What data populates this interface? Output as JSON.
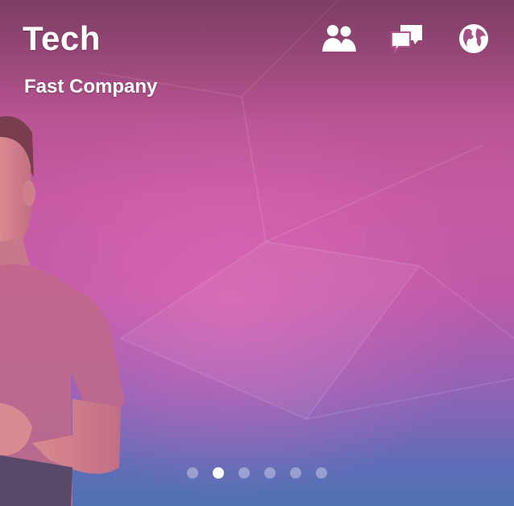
{
  "header": {
    "title": "Tech",
    "source": "Fast Company"
  },
  "toolbar": {
    "icons": [
      "people-icon",
      "chat-bubbles-icon",
      "globe-icon"
    ]
  },
  "pager": {
    "count": 6,
    "active_index": 1
  },
  "colors": {
    "top": "#9b4f7e",
    "middle": "#c65aa3",
    "bottom": "#4f72b3",
    "text": "#ffffff"
  }
}
